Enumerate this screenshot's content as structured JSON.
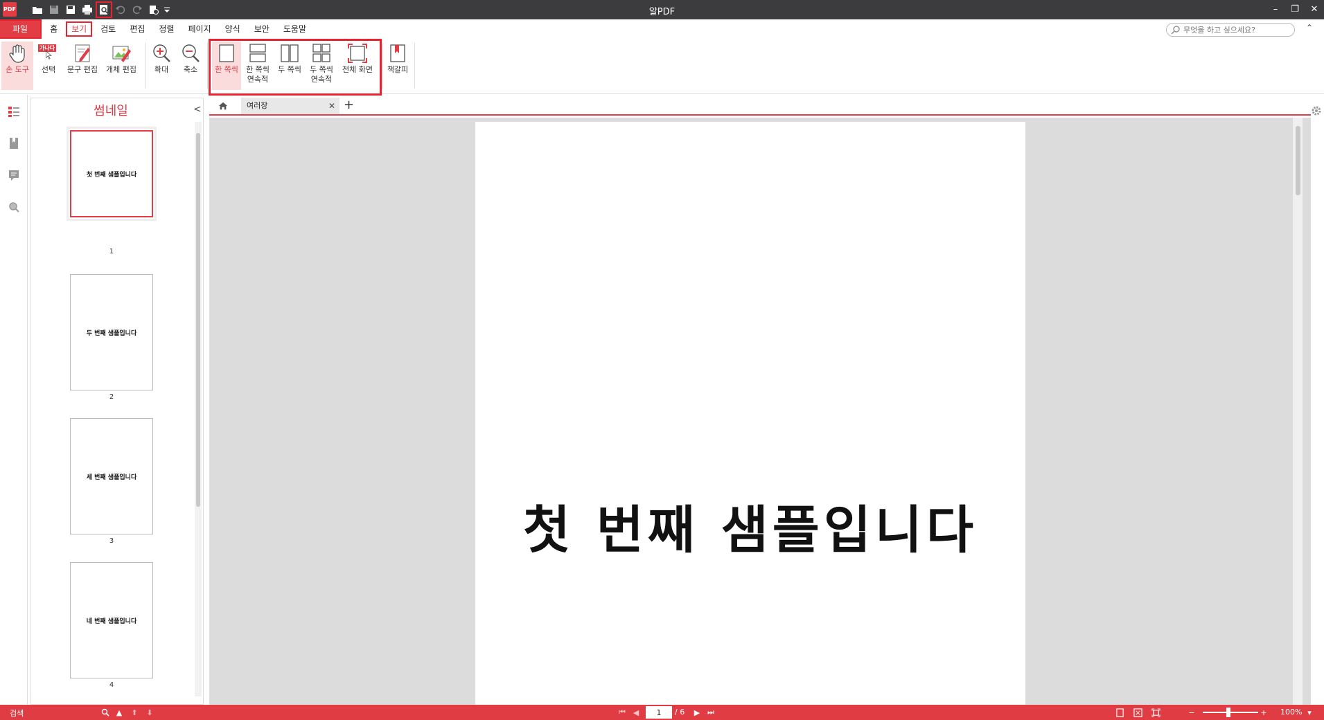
{
  "app": {
    "title": "알PDF",
    "logo": "PDF"
  },
  "quick_access": [
    "open-icon",
    "save-icon",
    "save-as-icon",
    "print-icon",
    "print-preview-icon",
    "undo-icon",
    "redo-icon",
    "document-properties-icon"
  ],
  "menus": {
    "file": "파일",
    "items": [
      {
        "id": "home",
        "label": "홈"
      },
      {
        "id": "view",
        "label": "보기",
        "active": true
      },
      {
        "id": "review",
        "label": "검토"
      },
      {
        "id": "edit",
        "label": "편집"
      },
      {
        "id": "arrange",
        "label": "정렬"
      },
      {
        "id": "page",
        "label": "페이지"
      },
      {
        "id": "form",
        "label": "양식"
      },
      {
        "id": "security",
        "label": "보안"
      },
      {
        "id": "help",
        "label": "도움말"
      }
    ]
  },
  "search": {
    "placeholder": "무엇을 하고 싶으세요?"
  },
  "ribbon": {
    "hand_tool": "손 도구",
    "select": "선택",
    "select_badge": "가나다",
    "text_edit": "문구 편집",
    "object_edit": "개체 편집",
    "zoom_in": "확대",
    "zoom_out": "축소",
    "single_page": "한 쪽씩",
    "single_continuous": "한 쪽씩\n연속적",
    "two_page": "두 쪽씩",
    "two_continuous": "두 쪽씩\n연속적",
    "fullscreen": "전체 화면",
    "bookmark": "책갈피"
  },
  "thumbnails": {
    "title": "썸네일",
    "items": [
      {
        "text": "첫 번째 샘플입니다",
        "num": "1"
      },
      {
        "text": "두 번째 샘플입니다",
        "num": "2"
      },
      {
        "text": "세 번째 샘플입니다",
        "num": "3"
      },
      {
        "text": "네 번째 샘플입니다",
        "num": "4"
      }
    ]
  },
  "tabs": {
    "doc_name": "여러장"
  },
  "document": {
    "page_text": "첫 번째 샘플입니다"
  },
  "status": {
    "search_label": "검색",
    "current_page": "1",
    "total": "/ 6",
    "zoom": "100%"
  },
  "colors": {
    "accent": "#e23c44",
    "titlebar": "#3c3c3f",
    "statusbar": "#e03c43",
    "highlight": "#e8222f"
  }
}
